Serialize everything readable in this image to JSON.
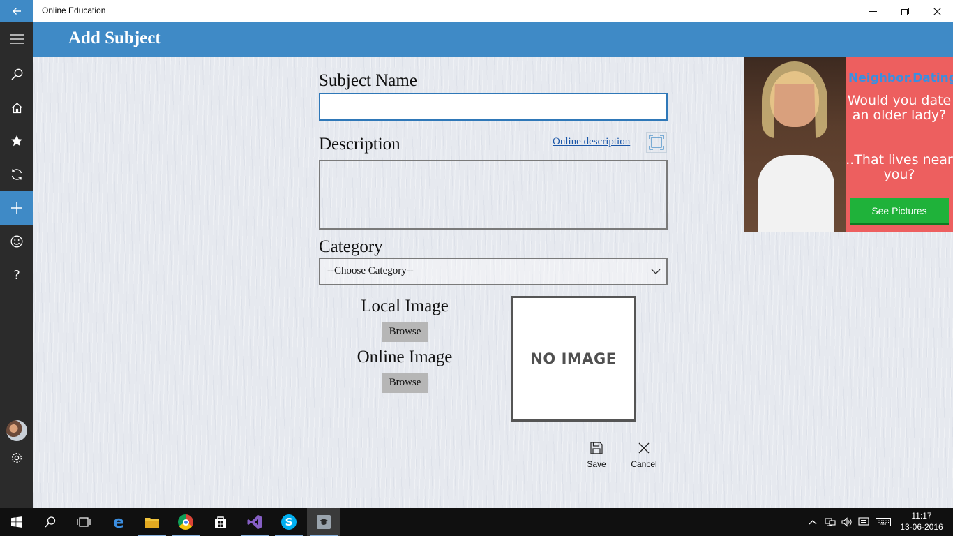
{
  "window": {
    "app_title": "Online Education"
  },
  "header": {
    "page_title": "Add Subject"
  },
  "sidebar": {
    "items": [
      {
        "icon": "hamburger-menu-icon"
      },
      {
        "icon": "search-icon"
      },
      {
        "icon": "home-icon"
      },
      {
        "icon": "star-icon"
      },
      {
        "icon": "sync-icon"
      },
      {
        "icon": "add-icon",
        "active": true
      },
      {
        "icon": "smiley-icon"
      },
      {
        "icon": "help-icon"
      }
    ],
    "bottom": [
      {
        "icon": "avatar"
      },
      {
        "icon": "settings-icon"
      }
    ]
  },
  "form": {
    "subject_name_label": "Subject Name",
    "subject_name_value": "",
    "description_label": "Description",
    "description_value": "",
    "online_description_link": "Online description",
    "category_label": "Category",
    "category_selected": "--Choose Category--",
    "local_image_label": "Local Image",
    "local_browse_label": "Browse",
    "online_image_label": "Online Image",
    "online_browse_label": "Browse",
    "no_image_text": "NO IMAGE"
  },
  "commands": {
    "save_label": "Save",
    "cancel_label": "Cancel"
  },
  "ad": {
    "brand": "Neighbor.Dating",
    "line1": "Would you date an older lady?",
    "line2": "..That lives near you?",
    "cta": "See Pictures"
  },
  "taskbar": {
    "time": "11:17",
    "date": "13-06-2016"
  },
  "colors": {
    "accent": "#3f8ac6",
    "sidebar": "#2b2b2b",
    "ad_red": "#ed5f5f",
    "ad_green": "#1fb23a"
  }
}
